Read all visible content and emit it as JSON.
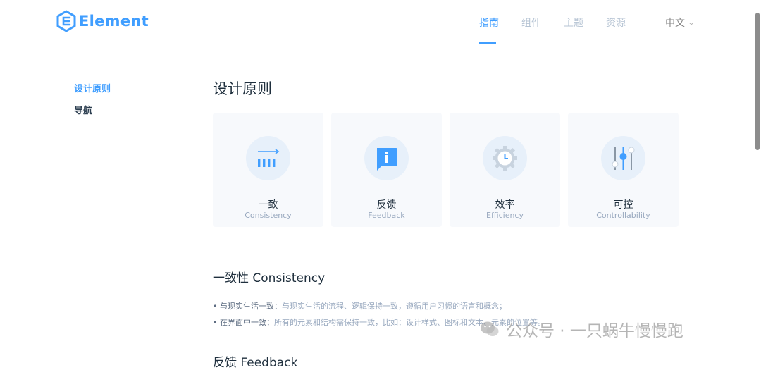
{
  "brand": {
    "name": "Element"
  },
  "nav": {
    "items": [
      {
        "label": "指南",
        "active": true
      },
      {
        "label": "组件",
        "active": false
      },
      {
        "label": "主题",
        "active": false
      },
      {
        "label": "资源",
        "active": false
      }
    ],
    "language": "中文"
  },
  "sidebar": {
    "items": [
      {
        "label": "设计原则",
        "active": true
      },
      {
        "label": "导航",
        "active": false
      }
    ]
  },
  "page": {
    "title": "设计原则"
  },
  "cards": [
    {
      "title": "一致",
      "subtitle": "Consistency",
      "icon": "consistency-icon"
    },
    {
      "title": "反馈",
      "subtitle": "Feedback",
      "icon": "feedback-icon"
    },
    {
      "title": "效率",
      "subtitle": "Efficiency",
      "icon": "efficiency-icon"
    },
    {
      "title": "可控",
      "subtitle": "Controllability",
      "icon": "controllability-icon"
    }
  ],
  "sections": [
    {
      "title": "一致性 Consistency",
      "bullets": [
        {
          "label": "与现实生活一致：",
          "text": "与现实生活的流程、逻辑保持一致，遵循用户习惯的语言和概念；"
        },
        {
          "label": "在界面中一致：",
          "text": "所有的元素和结构需保持一致，比如：设计样式、图标和文本、元素的位置等。"
        }
      ]
    },
    {
      "title": "反馈 Feedback"
    }
  ],
  "watermark": {
    "text": "公众号 · 一只蜗牛慢慢跑"
  },
  "colors": {
    "accent": "#409EFF",
    "text": "#1f2f3d",
    "muted": "#99a9bf"
  }
}
